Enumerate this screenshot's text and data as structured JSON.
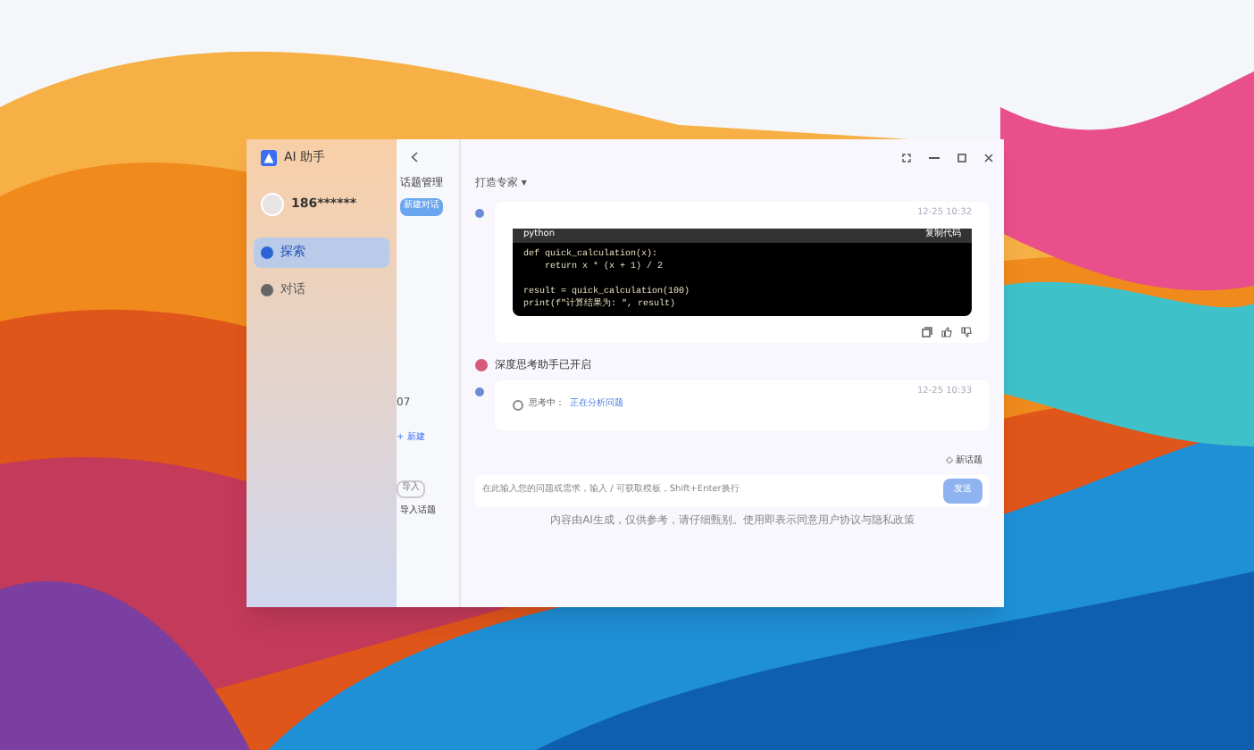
{
  "app": {
    "title": "AI 助手"
  },
  "user": {
    "name": "186******"
  },
  "nav": [
    {
      "label": "探索",
      "selected": true
    },
    {
      "label": "对话",
      "selected": false
    }
  ],
  "topics": {
    "title": "话题管理",
    "new_button": "新建对话",
    "count": "07",
    "add": "+ 新建",
    "import": "导入",
    "footer": "导入话题"
  },
  "header": {
    "assistant": "打造专家 ▾"
  },
  "messages": [
    {
      "kind": "code",
      "time": "12-25 10:32",
      "language": "python",
      "copy": "复制代码",
      "blocks": [
        [
          "def quick_calculation(x):",
          "    return x * (x + 1) / 2"
        ],
        [
          "result = quick_calculation(100)",
          "print(f\"计算结果为: \", result)"
        ]
      ]
    },
    {
      "kind": "thinking",
      "title": "深度思考助手已开启",
      "time": "12-25 10:33",
      "status": "思考中：",
      "detail": "正在分析问题"
    }
  ],
  "new_topic": "◇ 新话题",
  "input": {
    "placeholder": "在此输入您的问题或需求，输入 / 可获取模板，Shift+Enter换行",
    "send": "发送"
  },
  "disclaimer": "内容由AI生成，仅供参考，请仔细甄别。使用即表示同意用户协议与隐私政策"
}
